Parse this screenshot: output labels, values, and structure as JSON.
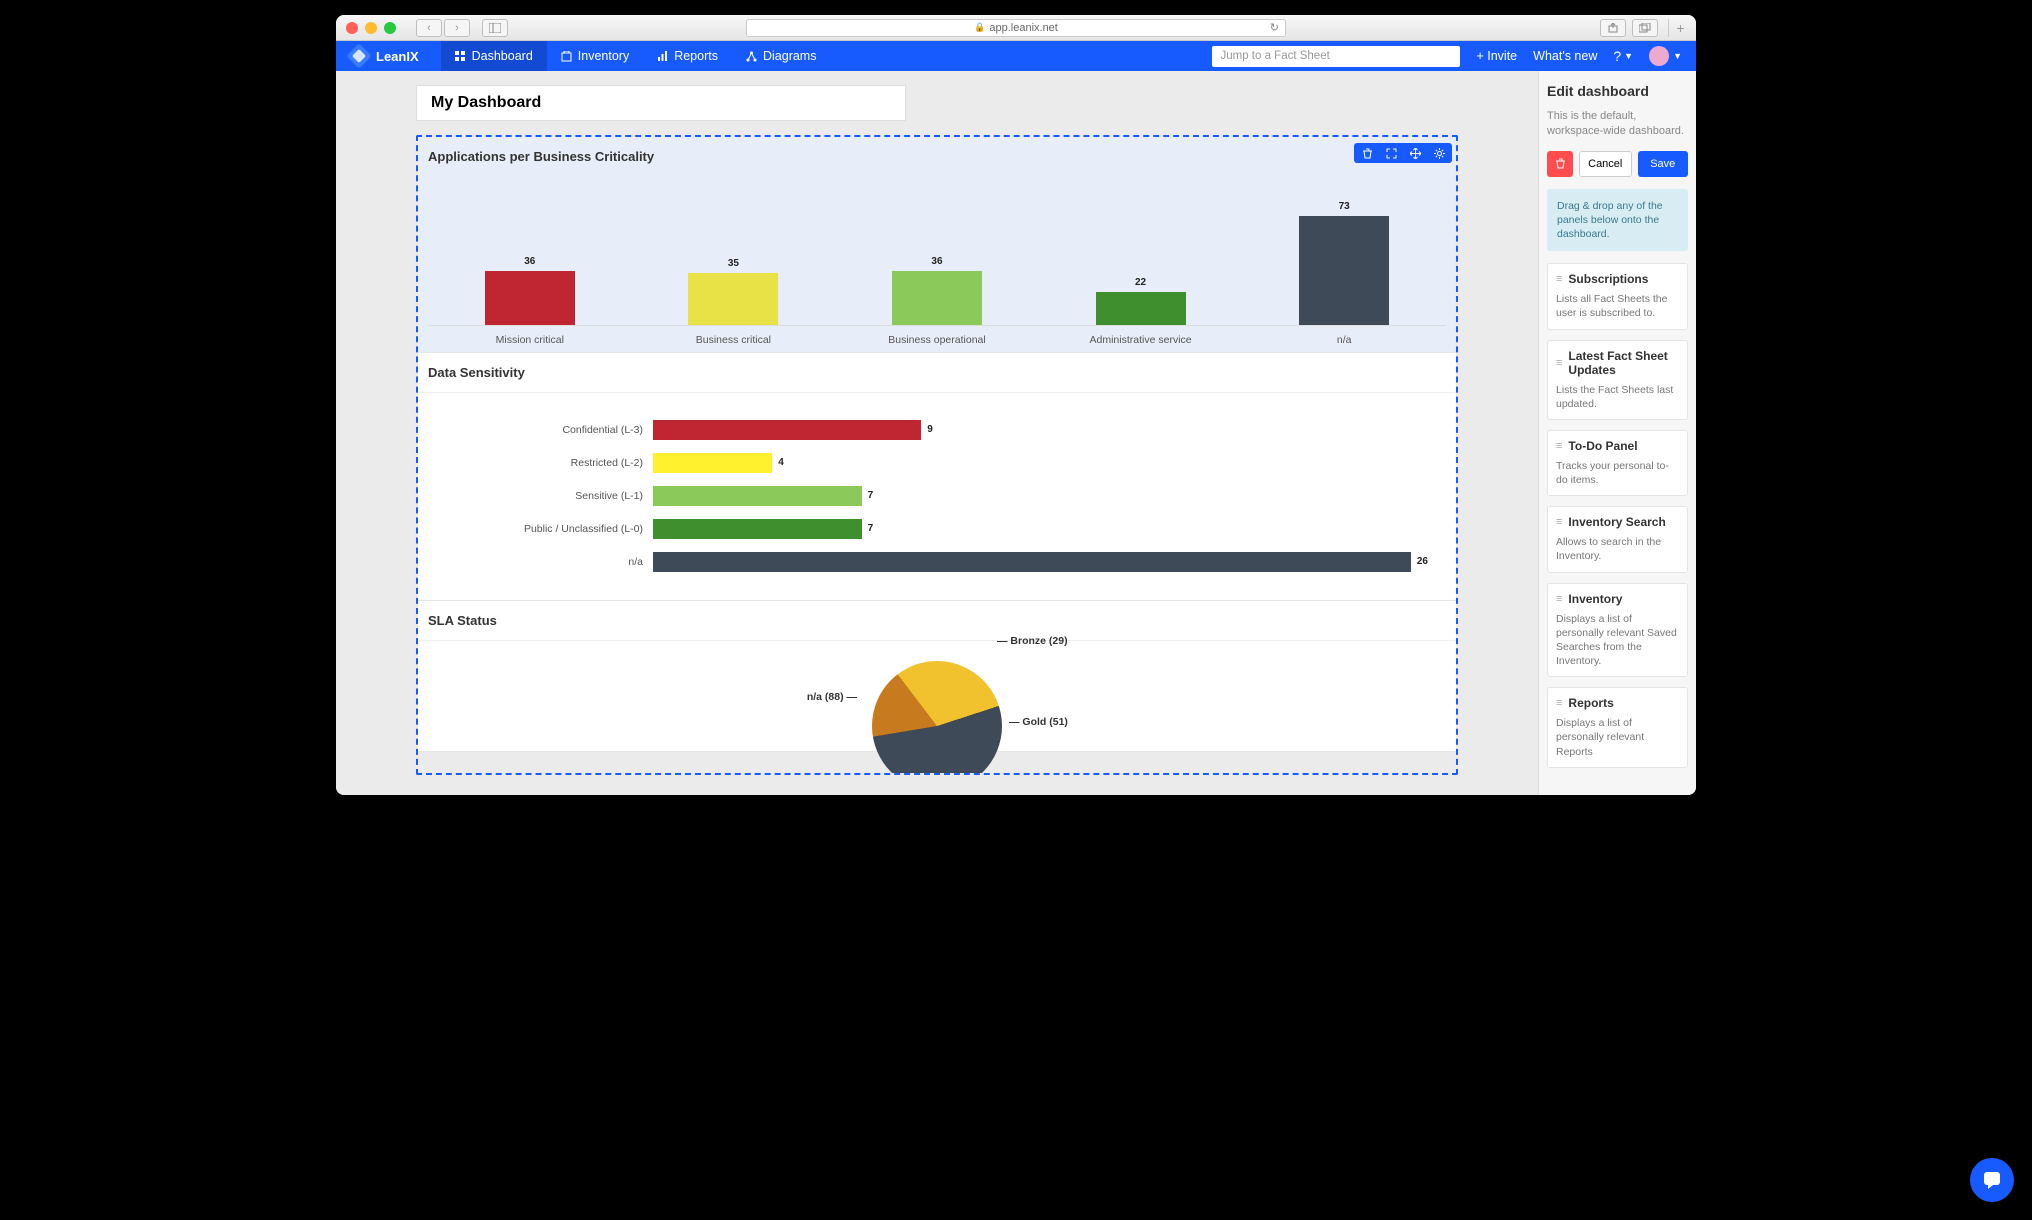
{
  "browser": {
    "url": "app.leanix.net"
  },
  "nav": {
    "brand": "LeanIX",
    "items": [
      "Dashboard",
      "Inventory",
      "Reports",
      "Diagrams"
    ],
    "search_placeholder": "Jump to a Fact Sheet",
    "invite": "+ Invite",
    "whatsnew": "What's new"
  },
  "dashboard": {
    "title": "My Dashboard",
    "widget1_title": "Applications per Business Criticality",
    "widget2_title": "Data Sensitivity",
    "widget3_title": "SLA Status"
  },
  "chart_data": [
    {
      "type": "bar",
      "title": "Applications per Business Criticality",
      "categories": [
        "Mission critical",
        "Business critical",
        "Business operational",
        "Administrative service",
        "n/a"
      ],
      "values": [
        36,
        35,
        36,
        22,
        73
      ],
      "colors": [
        "#c02631",
        "#e9e246",
        "#8cc95b",
        "#3f8f2e",
        "#3e4a57"
      ],
      "ylim": [
        0,
        80
      ]
    },
    {
      "type": "bar",
      "orientation": "horizontal",
      "title": "Data Sensitivity",
      "categories": [
        "Confidential (L-3)",
        "Restricted (L-2)",
        "Sensitive (L-1)",
        "Public / Unclassified (L-0)",
        "n/a"
      ],
      "values": [
        9,
        4,
        7,
        7,
        26
      ],
      "colors": [
        "#c02631",
        "#fff12d",
        "#8cc95b",
        "#3f8f2e",
        "#3e4a57"
      ],
      "xlim": [
        0,
        26
      ]
    },
    {
      "type": "pie",
      "title": "SLA Status",
      "series": [
        {
          "name": "n/a",
          "value": 88,
          "color": "#3e4a57"
        },
        {
          "name": "Bronze",
          "value": 29,
          "color": "#c77a1e"
        },
        {
          "name": "Gold",
          "value": 51,
          "color": "#f2c22e"
        }
      ],
      "labels": {
        "na": "n/a (88)",
        "bronze": "Bronze (29)",
        "gold": "Gold (51)"
      }
    }
  ],
  "rpanel": {
    "title": "Edit dashboard",
    "desc": "This is the default, workspace-wide dashboard.",
    "cancel": "Cancel",
    "save": "Save",
    "hint": "Drag & drop any of the panels below onto the dashboard.",
    "cards": [
      {
        "title": "Subscriptions",
        "desc": "Lists all Fact Sheets the user is subscribed to."
      },
      {
        "title": "Latest Fact Sheet Updates",
        "desc": "Lists the Fact Sheets last updated."
      },
      {
        "title": "To-Do Panel",
        "desc": "Tracks your personal to-do items."
      },
      {
        "title": "Inventory Search",
        "desc": "Allows to search in the Inventory."
      },
      {
        "title": "Inventory",
        "desc": "Displays a list of personally relevant Saved Searches from the Inventory."
      },
      {
        "title": "Reports",
        "desc": "Displays a list of personally relevant Reports"
      }
    ]
  }
}
